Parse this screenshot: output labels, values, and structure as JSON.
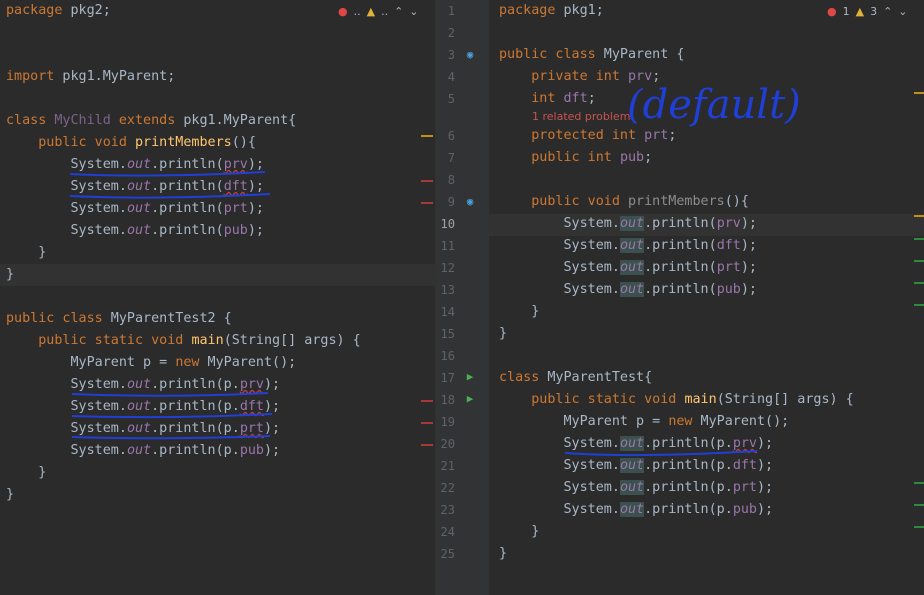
{
  "left_editor": {
    "lines": [
      "package pkg2;",
      "",
      "",
      "import pkg1.MyParent;",
      "",
      "class MyChild extends pkg1.MyParent{",
      "    public void printMembers(){",
      "        System.out.println(prv);",
      "        System.out.println(dft);",
      "        System.out.println(prt);",
      "        System.out.println(pub);",
      "    }",
      "}",
      "",
      "public class MyParentTest2 {",
      "    public static void main(String[] args) {",
      "        MyParent p = new MyParent();",
      "        System.out.println(p.prv);",
      "        System.out.println(p.dft);",
      "        System.out.println(p.prt);",
      "        System.out.println(p.pub);",
      "    }",
      "}"
    ],
    "inspection": {
      "errors_label": "..",
      "warnings_label": ".."
    }
  },
  "right_editor": {
    "line_numbers": [
      "1",
      "2",
      "3",
      "4",
      "5",
      "6",
      "7",
      "8",
      "9",
      "10",
      "11",
      "12",
      "13",
      "14",
      "15",
      "16",
      "17",
      "18",
      "19",
      "20",
      "21",
      "22",
      "23",
      "24",
      "25"
    ],
    "lines": [
      "package pkg1;",
      "",
      "public class MyParent {",
      "    private int prv;",
      "    int dft;",
      "    protected int prt;",
      "    public int pub;",
      "",
      "    public void printMembers(){",
      "        System.out.println(prv);",
      "        System.out.println(dft);",
      "        System.out.println(prt);",
      "        System.out.println(pub);",
      "    }",
      "}",
      "",
      "class MyParentTest{",
      "    public static void main(String[] args) {",
      "        MyParent p = new MyParent();",
      "        System.out.println(p.prv);",
      "        System.out.println(p.dft);",
      "        System.out.println(p.prt);",
      "        System.out.println(p.pub);",
      "    }",
      "}"
    ],
    "related_problem": "1 related problem",
    "inspection": {
      "errors_count": "1",
      "warnings_count": "3"
    },
    "current_line": "10"
  },
  "annotation": {
    "handwritten": "(default)"
  },
  "colors": {
    "background": "#2b2b2b",
    "keyword": "#cc7832",
    "method": "#ffc66d",
    "field": "#9876aa",
    "text": "#a9b7c6",
    "error": "#bc3f3c",
    "ink": "#1f3fd6"
  }
}
